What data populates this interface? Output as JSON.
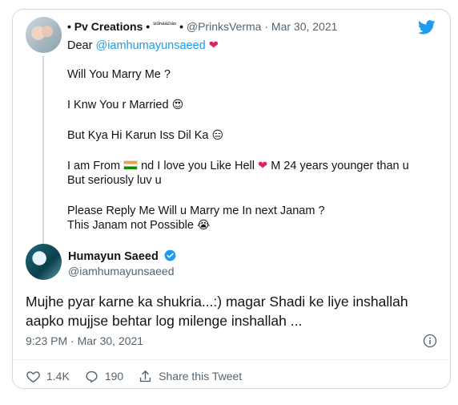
{
  "parent_tweet": {
    "author_name": "• Pv Creations •",
    "author_tiny": "ˢᶦᵈⁿᵃᵃᶻᶦᵃⁿ",
    "author_suffix": "•",
    "handle": "@PrinksVerma",
    "separator": "·",
    "date": "Mar 30, 2021",
    "line1_prefix": "Dear ",
    "line1_mention": "@iamhumayunsaeed",
    "line2": "Will You Marry Me ?",
    "line3": "I Knw You r Married",
    "line4": "But Kya Hi Karun Iss Dil Ka",
    "line5_a": "I am From ",
    "line5_b": " nd I love you Like Hell ",
    "line5_c": " M 24 years younger than u",
    "line6": "But seriously luv u",
    "line7": "Please Reply Me Will u Marry me In next Janam ?",
    "line8": "This Janam not Possible"
  },
  "main_tweet": {
    "author_name": "Humayun Saeed",
    "handle": "@iamhumayunsaeed",
    "text_line1": "Mujhe pyar karne ka shukria...:) magar Shadi ke liye inshallah",
    "text_line2": "aapko mujjse behtar log milenge inshallah ...",
    "time": "9:23 PM",
    "separator": "·",
    "date": "Mar 30, 2021"
  },
  "actions": {
    "likes": "1.4K",
    "replies": "190",
    "share_label": "Share this Tweet"
  },
  "colors": {
    "accent": "#1d9bf0",
    "heart": "#e0245e",
    "muted": "#536471"
  },
  "icons": [
    "twitter-bird-icon",
    "verified-badge-icon",
    "info-icon",
    "heart-icon",
    "reply-icon",
    "share-icon"
  ]
}
